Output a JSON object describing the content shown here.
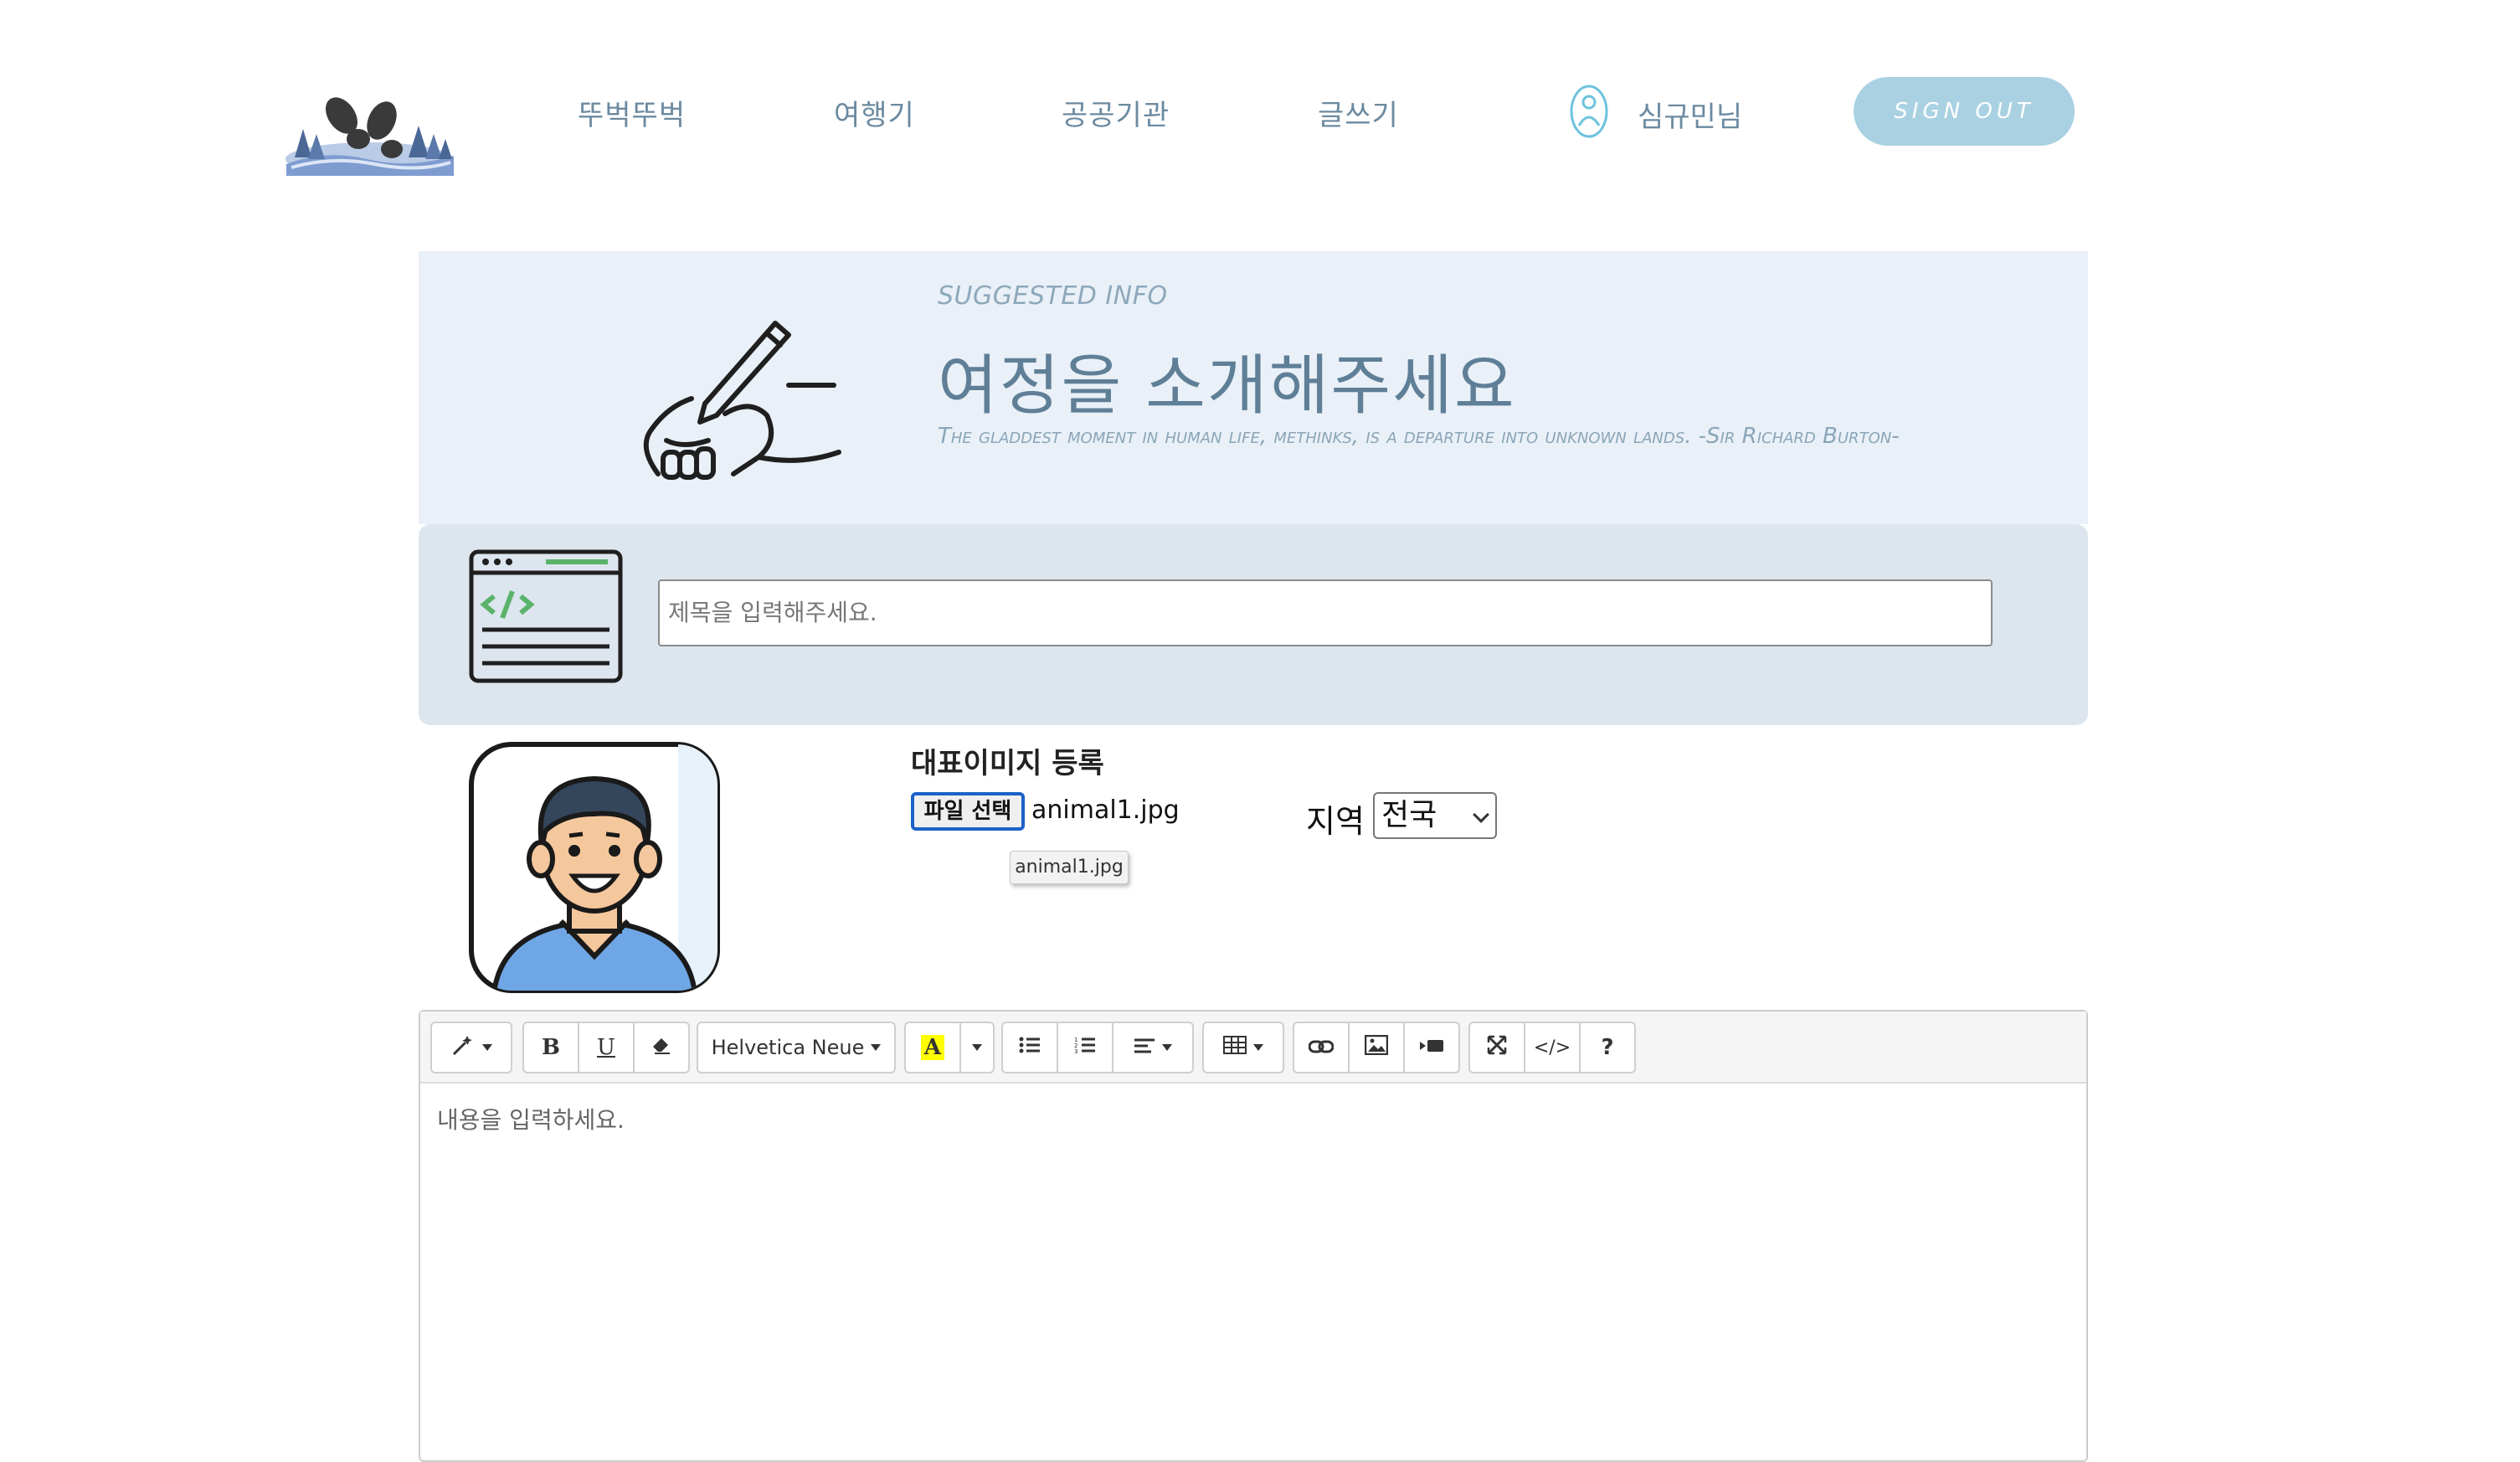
{
  "header": {
    "nav": [
      "뚜벅뚜벅",
      "여행기",
      "공공기관",
      "글쓰기"
    ],
    "user_name": "심규민님",
    "signout_label": "SIGN OUT"
  },
  "hero": {
    "small_label": "SUGGESTED INFO",
    "title": "여정을 소개해주세요",
    "quote": "The gladdest moment in human life, methinks, is a departure into unknown lands. -Sir Richard Burton-"
  },
  "title_section": {
    "placeholder": "제목을 입력해주세요."
  },
  "image_section": {
    "label": "대표이미지 등록",
    "file_button": "파일 선택",
    "file_name": "animal1.jpg",
    "tooltip": "animal1.jpg"
  },
  "region": {
    "label": "지역",
    "selected": "전국"
  },
  "editor": {
    "font_name": "Helvetica Neue",
    "placeholder": "내용을 입력하세요.",
    "toolbar_icons": [
      "magic-wand-icon",
      "bold-icon",
      "underline-icon",
      "eraser-icon",
      "font-family-dropdown",
      "text-color-icon",
      "color-dropdown-icon",
      "unordered-list-icon",
      "ordered-list-icon",
      "paragraph-align-icon",
      "table-icon",
      "link-icon",
      "picture-icon",
      "video-icon",
      "fullscreen-icon",
      "code-view-icon",
      "help-icon"
    ]
  },
  "colors": {
    "accent": "#a9d1e2",
    "nav_text": "#6c8aa0",
    "hero_bg": "#e9f0f7",
    "title_bg": "#dde6ef"
  }
}
